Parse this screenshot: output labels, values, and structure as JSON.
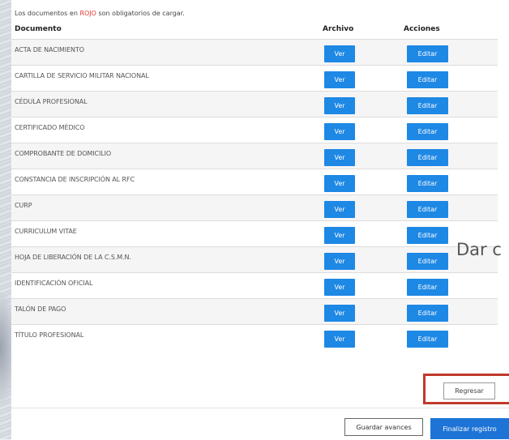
{
  "notice": {
    "prefix": "Los documentos en ",
    "highlight": "ROJO",
    "suffix": " son obligatorios de cargar.",
    "highlight_color": "#e53935"
  },
  "table": {
    "columns": [
      "Documento",
      "Archivo",
      "Acciones"
    ],
    "rows": [
      {
        "name": "ACTA DE NACIMIENTO",
        "ver": "Ver",
        "edit": "Editar"
      },
      {
        "name": "CARTILLA DE SERVICIO MILITAR NACIONAL",
        "ver": "Ver",
        "edit": "Editar"
      },
      {
        "name": "CÉDULA PROFESIONAL",
        "ver": "Ver",
        "edit": "Editar"
      },
      {
        "name": "CERTIFICADO MÉDICO",
        "ver": "Ver",
        "edit": "Editar"
      },
      {
        "name": "COMPROBANTE DE DOMICILIO",
        "ver": "Ver",
        "edit": "Editar"
      },
      {
        "name": "CONSTANCIA DE INSCRIPCIÓN AL RFC",
        "ver": "Ver",
        "edit": "Editar"
      },
      {
        "name": "CURP",
        "ver": "Ver",
        "edit": "Editar"
      },
      {
        "name": "CURRICULUM VITAE",
        "ver": "Ver",
        "edit": "Editar"
      },
      {
        "name": "HOJA DE LIBERACIÓN DE LA C.S.M.N.",
        "ver": "Ver",
        "edit": "Editar"
      },
      {
        "name": "IDENTIFICACIÓN OFICIAL",
        "ver": "Ver",
        "edit": "Editar"
      },
      {
        "name": "TALÓN DE PAGO",
        "ver": "Ver",
        "edit": "Editar"
      },
      {
        "name": "TÍTULO PROFESIONAL",
        "ver": "Ver",
        "edit": "Editar"
      }
    ]
  },
  "overlay_text": "Dar c",
  "buttons": {
    "back": "Regresar",
    "save": "Guardar avances",
    "finish": "Finalizar registro"
  },
  "colors": {
    "primary": "#1e88e5",
    "highlight_border": "#c0392b"
  }
}
